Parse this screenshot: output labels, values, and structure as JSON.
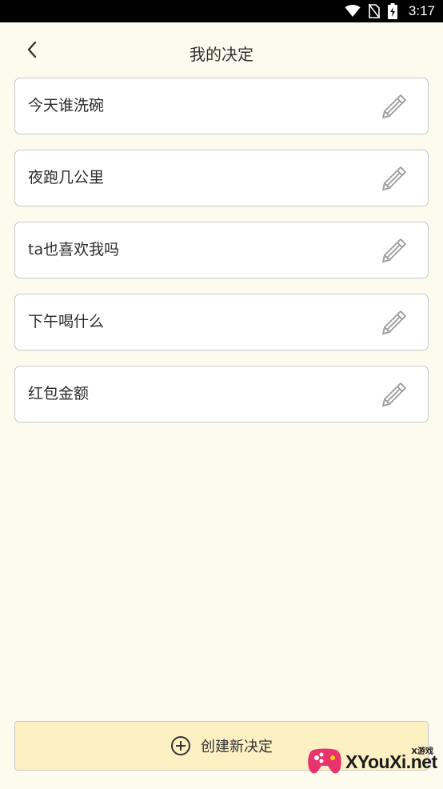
{
  "status_bar": {
    "time": "3:17",
    "icons": [
      "wifi-icon",
      "no-sim-icon",
      "battery-charging-icon"
    ]
  },
  "header": {
    "title": "我的决定",
    "back_icon": "chevron-left-icon"
  },
  "decisions": [
    {
      "label": "今天谁洗碗"
    },
    {
      "label": "夜跑几公里"
    },
    {
      "label": "ta也喜欢我吗"
    },
    {
      "label": "下午喝什么"
    },
    {
      "label": "红包金额"
    }
  ],
  "edit_icon": "pencil-icon",
  "create_button": {
    "label": "创建新决定",
    "icon": "plus-circle-icon"
  },
  "watermark": {
    "text": "XYouXi.net",
    "sub": "X游戏"
  },
  "colors": {
    "background": "#fdfaee",
    "button_bg": "#fdf1c4",
    "border": "#c8c8c8"
  }
}
